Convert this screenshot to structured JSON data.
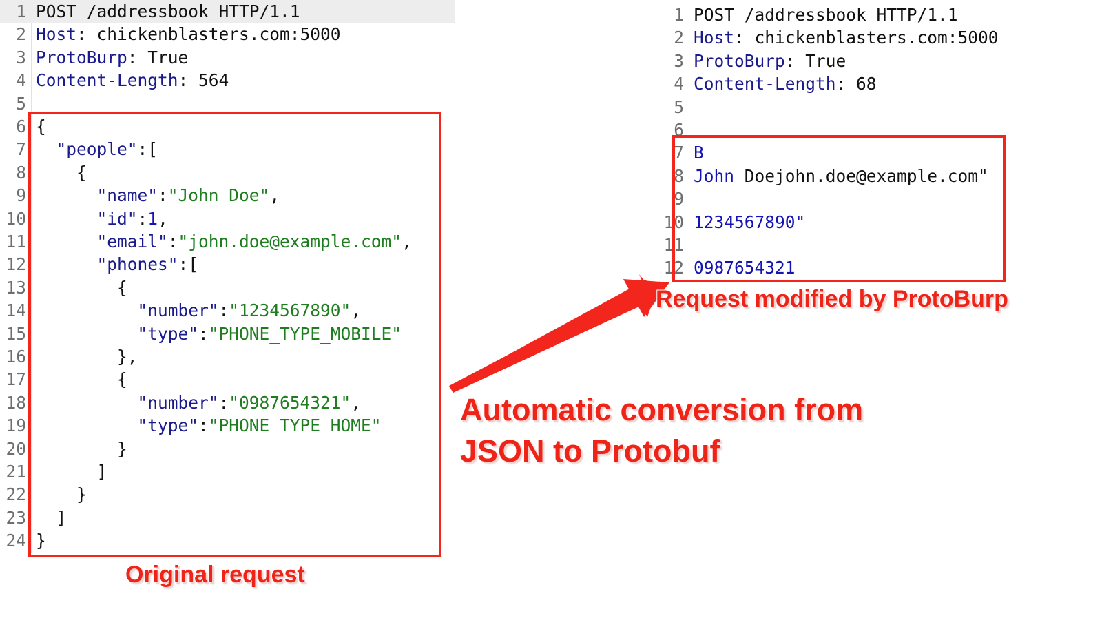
{
  "left_request": {
    "header_lines": [
      {
        "num": "1",
        "method": "POST",
        "path": "/addressbook HTTP/1.1"
      },
      {
        "num": "2",
        "key": "Host",
        "val": "chickenblasters.com:5000"
      },
      {
        "num": "3",
        "key": "ProtoBurp",
        "val": "True"
      },
      {
        "num": "4",
        "key": "Content-Length",
        "val": "564"
      },
      {
        "num": "5"
      }
    ],
    "body_lines": [
      {
        "num": "6",
        "text": "{"
      },
      {
        "num": "7",
        "key": "\"people\"",
        "rest": ":["
      },
      {
        "num": "8",
        "text": "    {"
      },
      {
        "num": "9",
        "key": "\"name\"",
        "str": "\"John Doe\"",
        "tail": ","
      },
      {
        "num": "10",
        "key": "\"id\"",
        "numval": "1",
        "tail": ","
      },
      {
        "num": "11",
        "key": "\"email\"",
        "str": "\"john.doe@example.com\"",
        "tail": ","
      },
      {
        "num": "12",
        "key": "\"phones\"",
        "rest": ":["
      },
      {
        "num": "13",
        "text": "        {"
      },
      {
        "num": "14",
        "key": "\"number\"",
        "str": "\"1234567890\"",
        "tail": ","
      },
      {
        "num": "15",
        "key": "\"type\"",
        "str": "\"PHONE_TYPE_MOBILE\"",
        "tail": ""
      },
      {
        "num": "16",
        "text": "        },"
      },
      {
        "num": "17",
        "text": "        {"
      },
      {
        "num": "18",
        "key": "\"number\"",
        "str": "\"0987654321\"",
        "tail": ","
      },
      {
        "num": "19",
        "key": "\"type\"",
        "str": "\"PHONE_TYPE_HOME\"",
        "tail": ""
      },
      {
        "num": "20",
        "text": "        }"
      },
      {
        "num": "21",
        "text": "      ]"
      },
      {
        "num": "22",
        "text": "    }"
      },
      {
        "num": "23",
        "text": "  ]"
      },
      {
        "num": "24",
        "text": "}"
      }
    ]
  },
  "right_request": {
    "header_lines": [
      {
        "num": "1",
        "method": "POST",
        "path": "/addressbook HTTP/1.1"
      },
      {
        "num": "2",
        "key": "Host",
        "val": "chickenblasters.com:5000"
      },
      {
        "num": "3",
        "key": "ProtoBurp",
        "val": "True"
      },
      {
        "num": "4",
        "key": "Content-Length",
        "val": "68"
      },
      {
        "num": "5"
      },
      {
        "num": "6"
      }
    ],
    "body_lines": [
      {
        "num": "7",
        "blue": "B",
        "plain": ""
      },
      {
        "num": "8",
        "blue": "John",
        "plain": " Doejohn.doe@example.com\""
      },
      {
        "num": "9",
        "blue": "",
        "plain": ""
      },
      {
        "num": "10",
        "blue": "1234567890\"",
        "plain": ""
      },
      {
        "num": "11",
        "blue": "",
        "plain": ""
      },
      {
        "num": "12",
        "blue": "0987654321",
        "plain": ""
      }
    ]
  },
  "captions": {
    "original": "Original request",
    "modified": "Request modified by ProtoBurp",
    "conversion_line1": "Automatic conversion from",
    "conversion_line2": "JSON to Protobuf"
  },
  "colors": {
    "annotation_red": "#f2261c",
    "header_key": "#1a1a8c",
    "string": "#1e7d1e",
    "number": "#1414b4"
  }
}
